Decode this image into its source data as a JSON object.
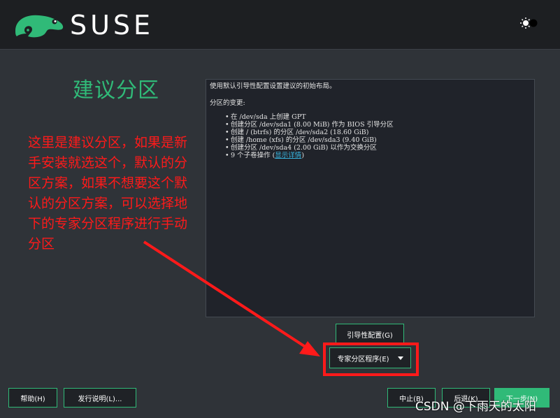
{
  "header": {
    "brand": "SUSE"
  },
  "page_title": "建议分区",
  "annotation": "这里是建议分区，如果是新手安装就选这个，默认的分区方案，如果不想要这个默认的分区方案，可以选择地下的专家分区程序进行手动分区",
  "proposal": {
    "intro": "使用默认引导性配置设置建议的初始布局。",
    "changes_heading": "分区的变更:",
    "items": [
      "在 /dev/sda 上创建 GPT",
      "创建分区 /dev/sda1 (8.00 MiB) 作为 BIOS 引导分区",
      "创建 / (btrfs) 的分区 /dev/sda2 (18.60 GiB)",
      "创建 /home (xfs) 的分区 /dev/sda3 (9.40 GiB)",
      "创建分区 /dev/sda4 (2.00 GiB) 以作为交换分区"
    ],
    "subvolume_text": "9 个子卷操作 (",
    "subvolume_link": "显示详情",
    "subvolume_close": ")"
  },
  "buttons": {
    "guided_setup": "引导性配置(G)",
    "expert_partitioner": "专家分区程序(E)",
    "help": "帮助(H)",
    "release_notes": "发行说明(L)...",
    "abort": "中止(B)",
    "back": "后退(K)",
    "next": "下一步(N)"
  },
  "watermark": "CSDN @下雨天的太阳",
  "colors": {
    "accent": "#30ba78",
    "annotation_red": "#ff1a1a",
    "link": "#37b5e0"
  },
  "icons": {
    "logo": "suse-chameleon-icon",
    "theme_toggle": "sun-moon-icon",
    "dropdown": "caret-down-icon"
  }
}
